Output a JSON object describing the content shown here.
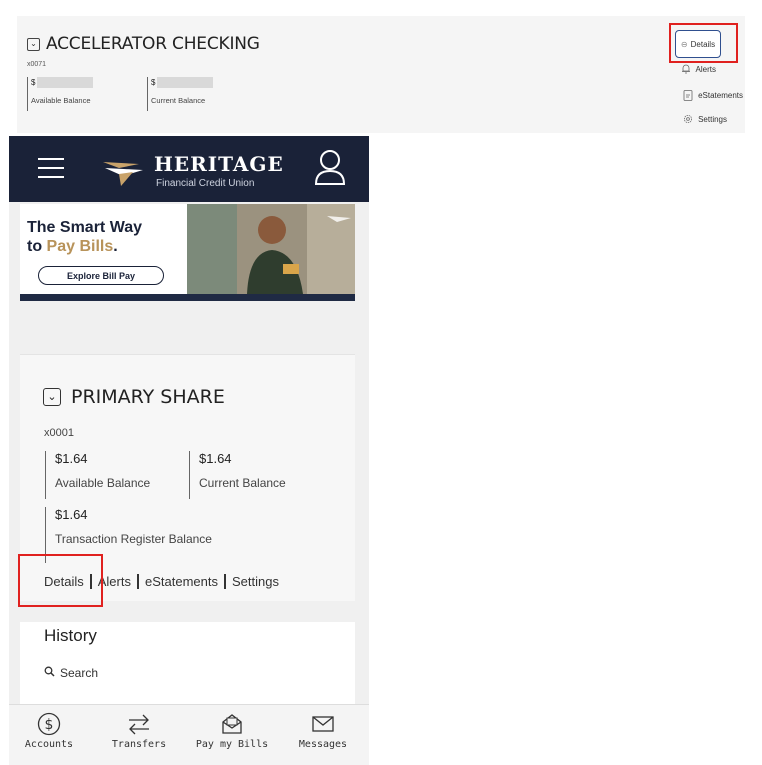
{
  "desktop_card": {
    "title": "ACCELERATOR CHECKING",
    "account_number": "x0071",
    "currency_symbol": "$",
    "available_label": "Available Balance",
    "current_label": "Current Balance",
    "links": {
      "details": "Details",
      "alerts": "Alerts",
      "estatements": "eStatements",
      "settings": "Settings"
    }
  },
  "mobile": {
    "header": {
      "logo_word": "HERITAGE",
      "logo_sub": "Financial Credit Union"
    },
    "banner": {
      "line1": "The Smart Way",
      "line2_prefix": "to ",
      "line2_highlight": "Pay Bills",
      "line2_suffix": ".",
      "cta": "Explore Bill Pay"
    },
    "account_card": {
      "title": "PRIMARY SHARE",
      "account_number": "x0001",
      "available_amount": "$1.64",
      "available_label": "Available Balance",
      "current_amount": "$1.64",
      "current_label": "Current Balance",
      "register_amount": "$1.64",
      "register_label": "Transaction Register Balance",
      "links": {
        "details": "Details",
        "alerts": "Alerts",
        "estatements": "eStatements",
        "settings": "Settings"
      }
    },
    "history": {
      "heading": "History",
      "search": "Search"
    },
    "tabbar": {
      "accounts": "Accounts",
      "transfers": "Transfers",
      "pay_bills": "Pay my Bills",
      "messages": "Messages"
    }
  },
  "colors": {
    "header_bg": "#1a2238",
    "highlight_gold": "#b8935a",
    "annotation_red": "#e0211f"
  },
  "icons": [
    "chevron-down-icon",
    "details-icon",
    "bell-icon",
    "document-icon",
    "gear-icon",
    "hamburger-icon",
    "user-icon",
    "dollar-icon",
    "transfer-icon",
    "envelope-open-icon",
    "envelope-icon",
    "search-icon"
  ]
}
